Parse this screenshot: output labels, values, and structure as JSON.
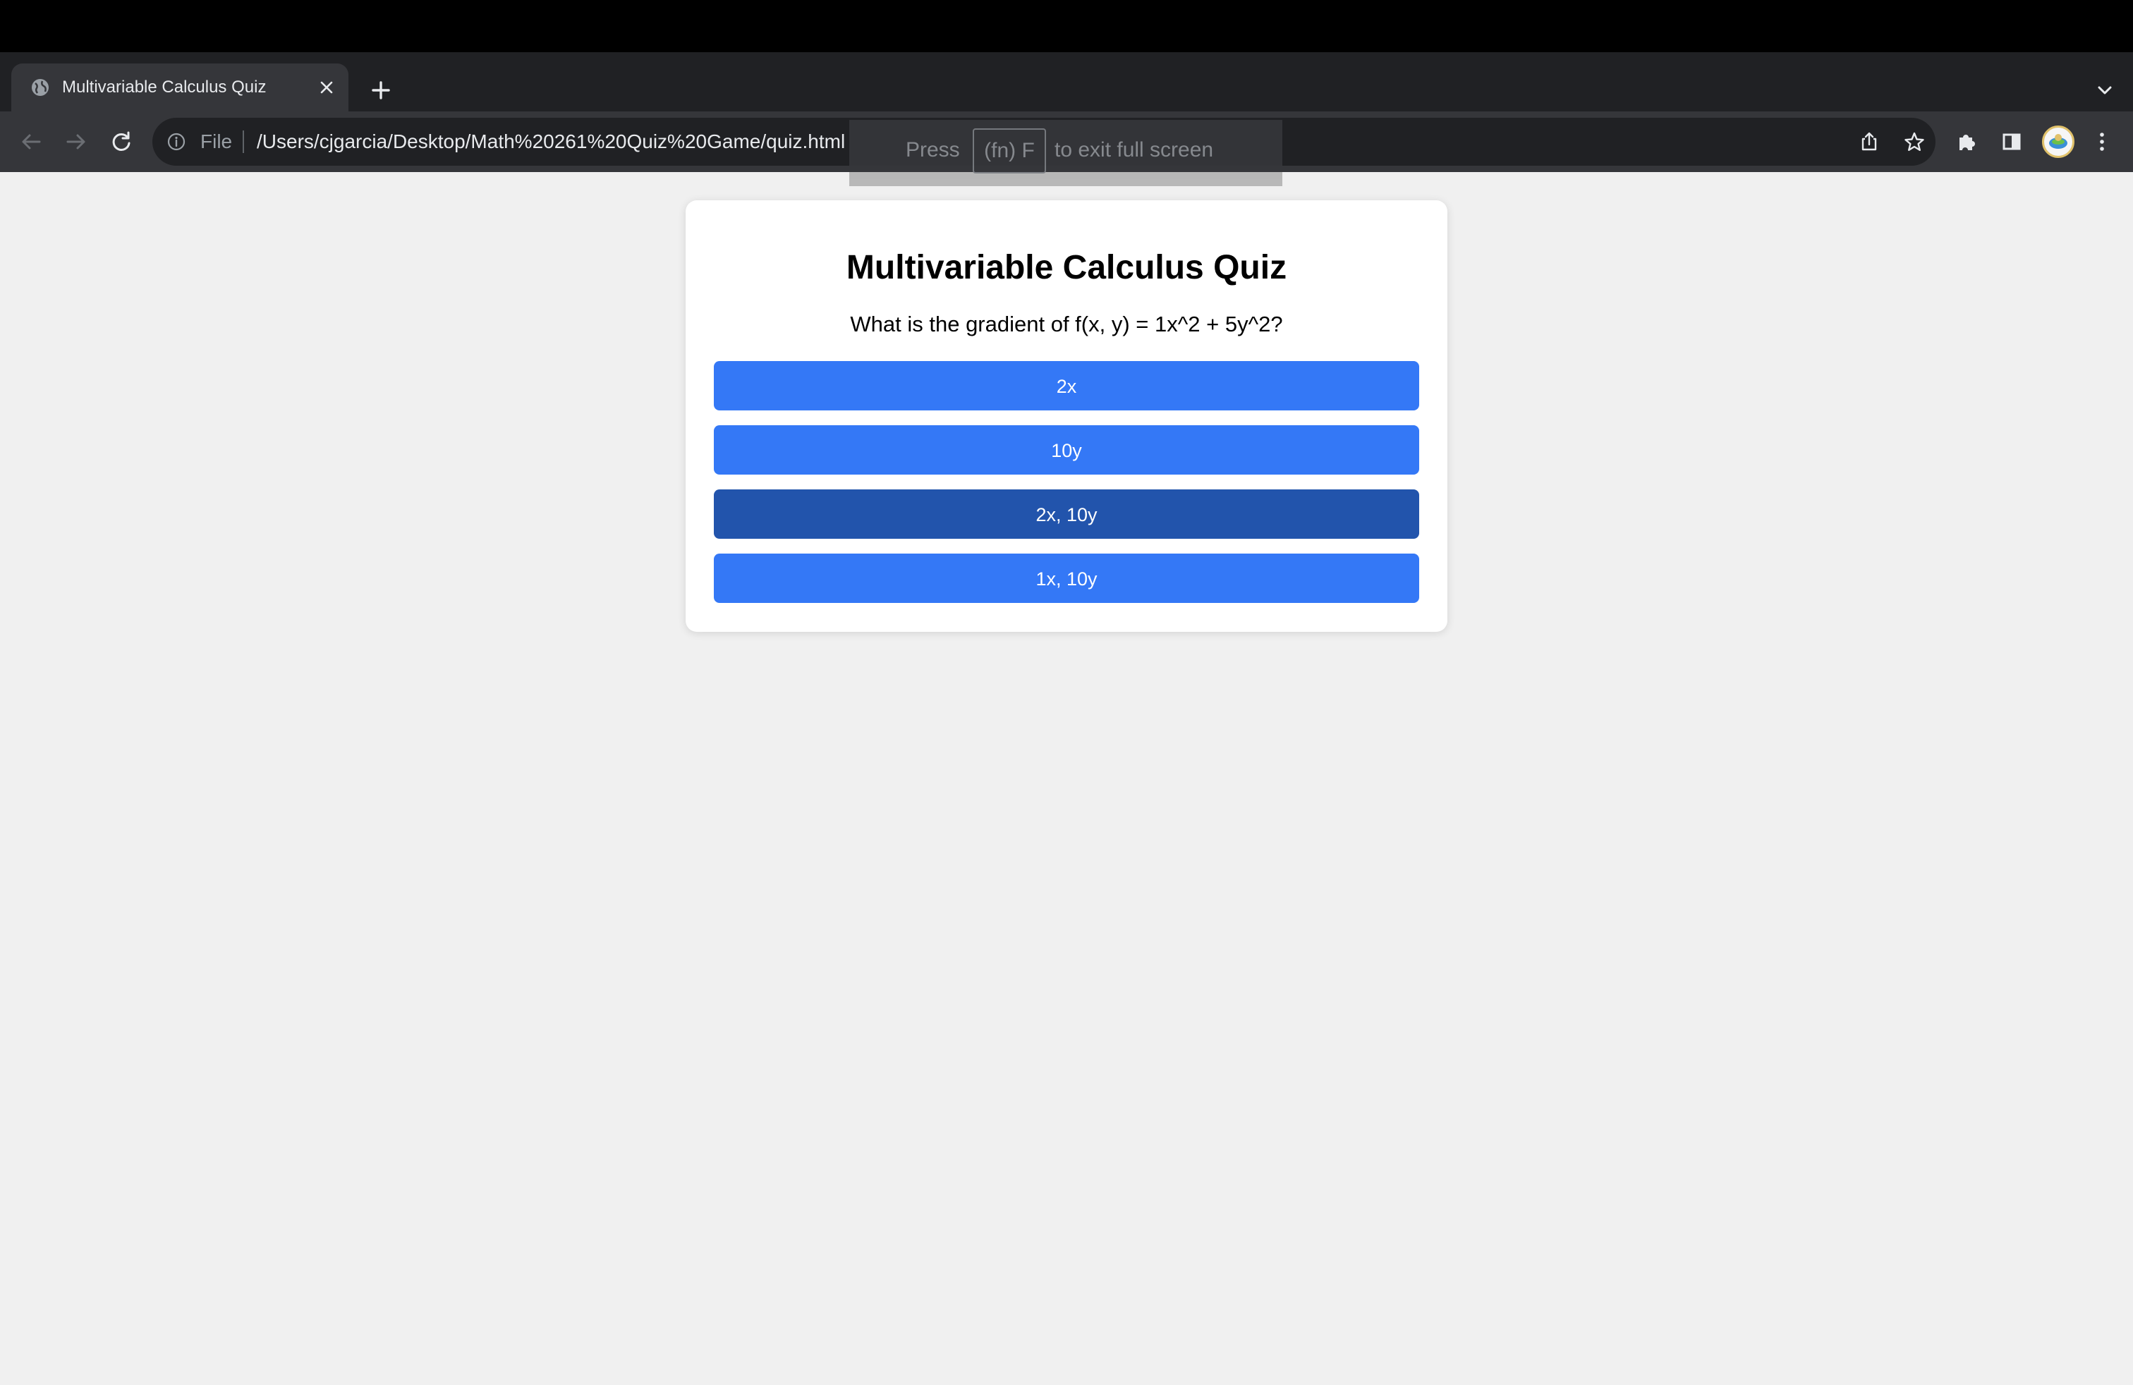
{
  "browser": {
    "tab": {
      "title": "Multivariable Calculus Quiz"
    },
    "omnibox": {
      "scheme_label": "File",
      "url": "/Users/cjgarcia/Desktop/Math%20261%20Quiz%20Game/quiz.html"
    },
    "fullscreen_notice": {
      "prefix": "Press",
      "key": "(fn) F",
      "suffix": "to exit full screen"
    }
  },
  "quiz": {
    "title": "Multivariable Calculus Quiz",
    "question": "What is the gradient of f(x, y) = 1x^2 + 5y^2?",
    "answers": [
      {
        "label": "2x"
      },
      {
        "label": "10y"
      },
      {
        "label": "2x, 10y"
      },
      {
        "label": "1x, 10y"
      }
    ],
    "hovered_answer_index": 2
  },
  "colors": {
    "answer_button": "#3478f6",
    "answer_button_hover": "#2254ac",
    "page_background": "#f0f0f0",
    "browser_dark": "#202124",
    "toolbar": "#35363a"
  },
  "icons": {
    "tab_favicon": "globe-icon",
    "tab_close": "close-icon",
    "new_tab": "plus-icon",
    "tab_list": "chevron-down-icon",
    "back": "arrow-left-icon",
    "forward": "arrow-right-icon",
    "reload": "reload-icon",
    "site_info": "info-icon",
    "share": "share-icon",
    "bookmark": "star-icon",
    "extensions": "puzzle-icon",
    "side_panel": "side-panel-icon",
    "profile": "avatar",
    "menu": "kebab-menu-icon"
  }
}
